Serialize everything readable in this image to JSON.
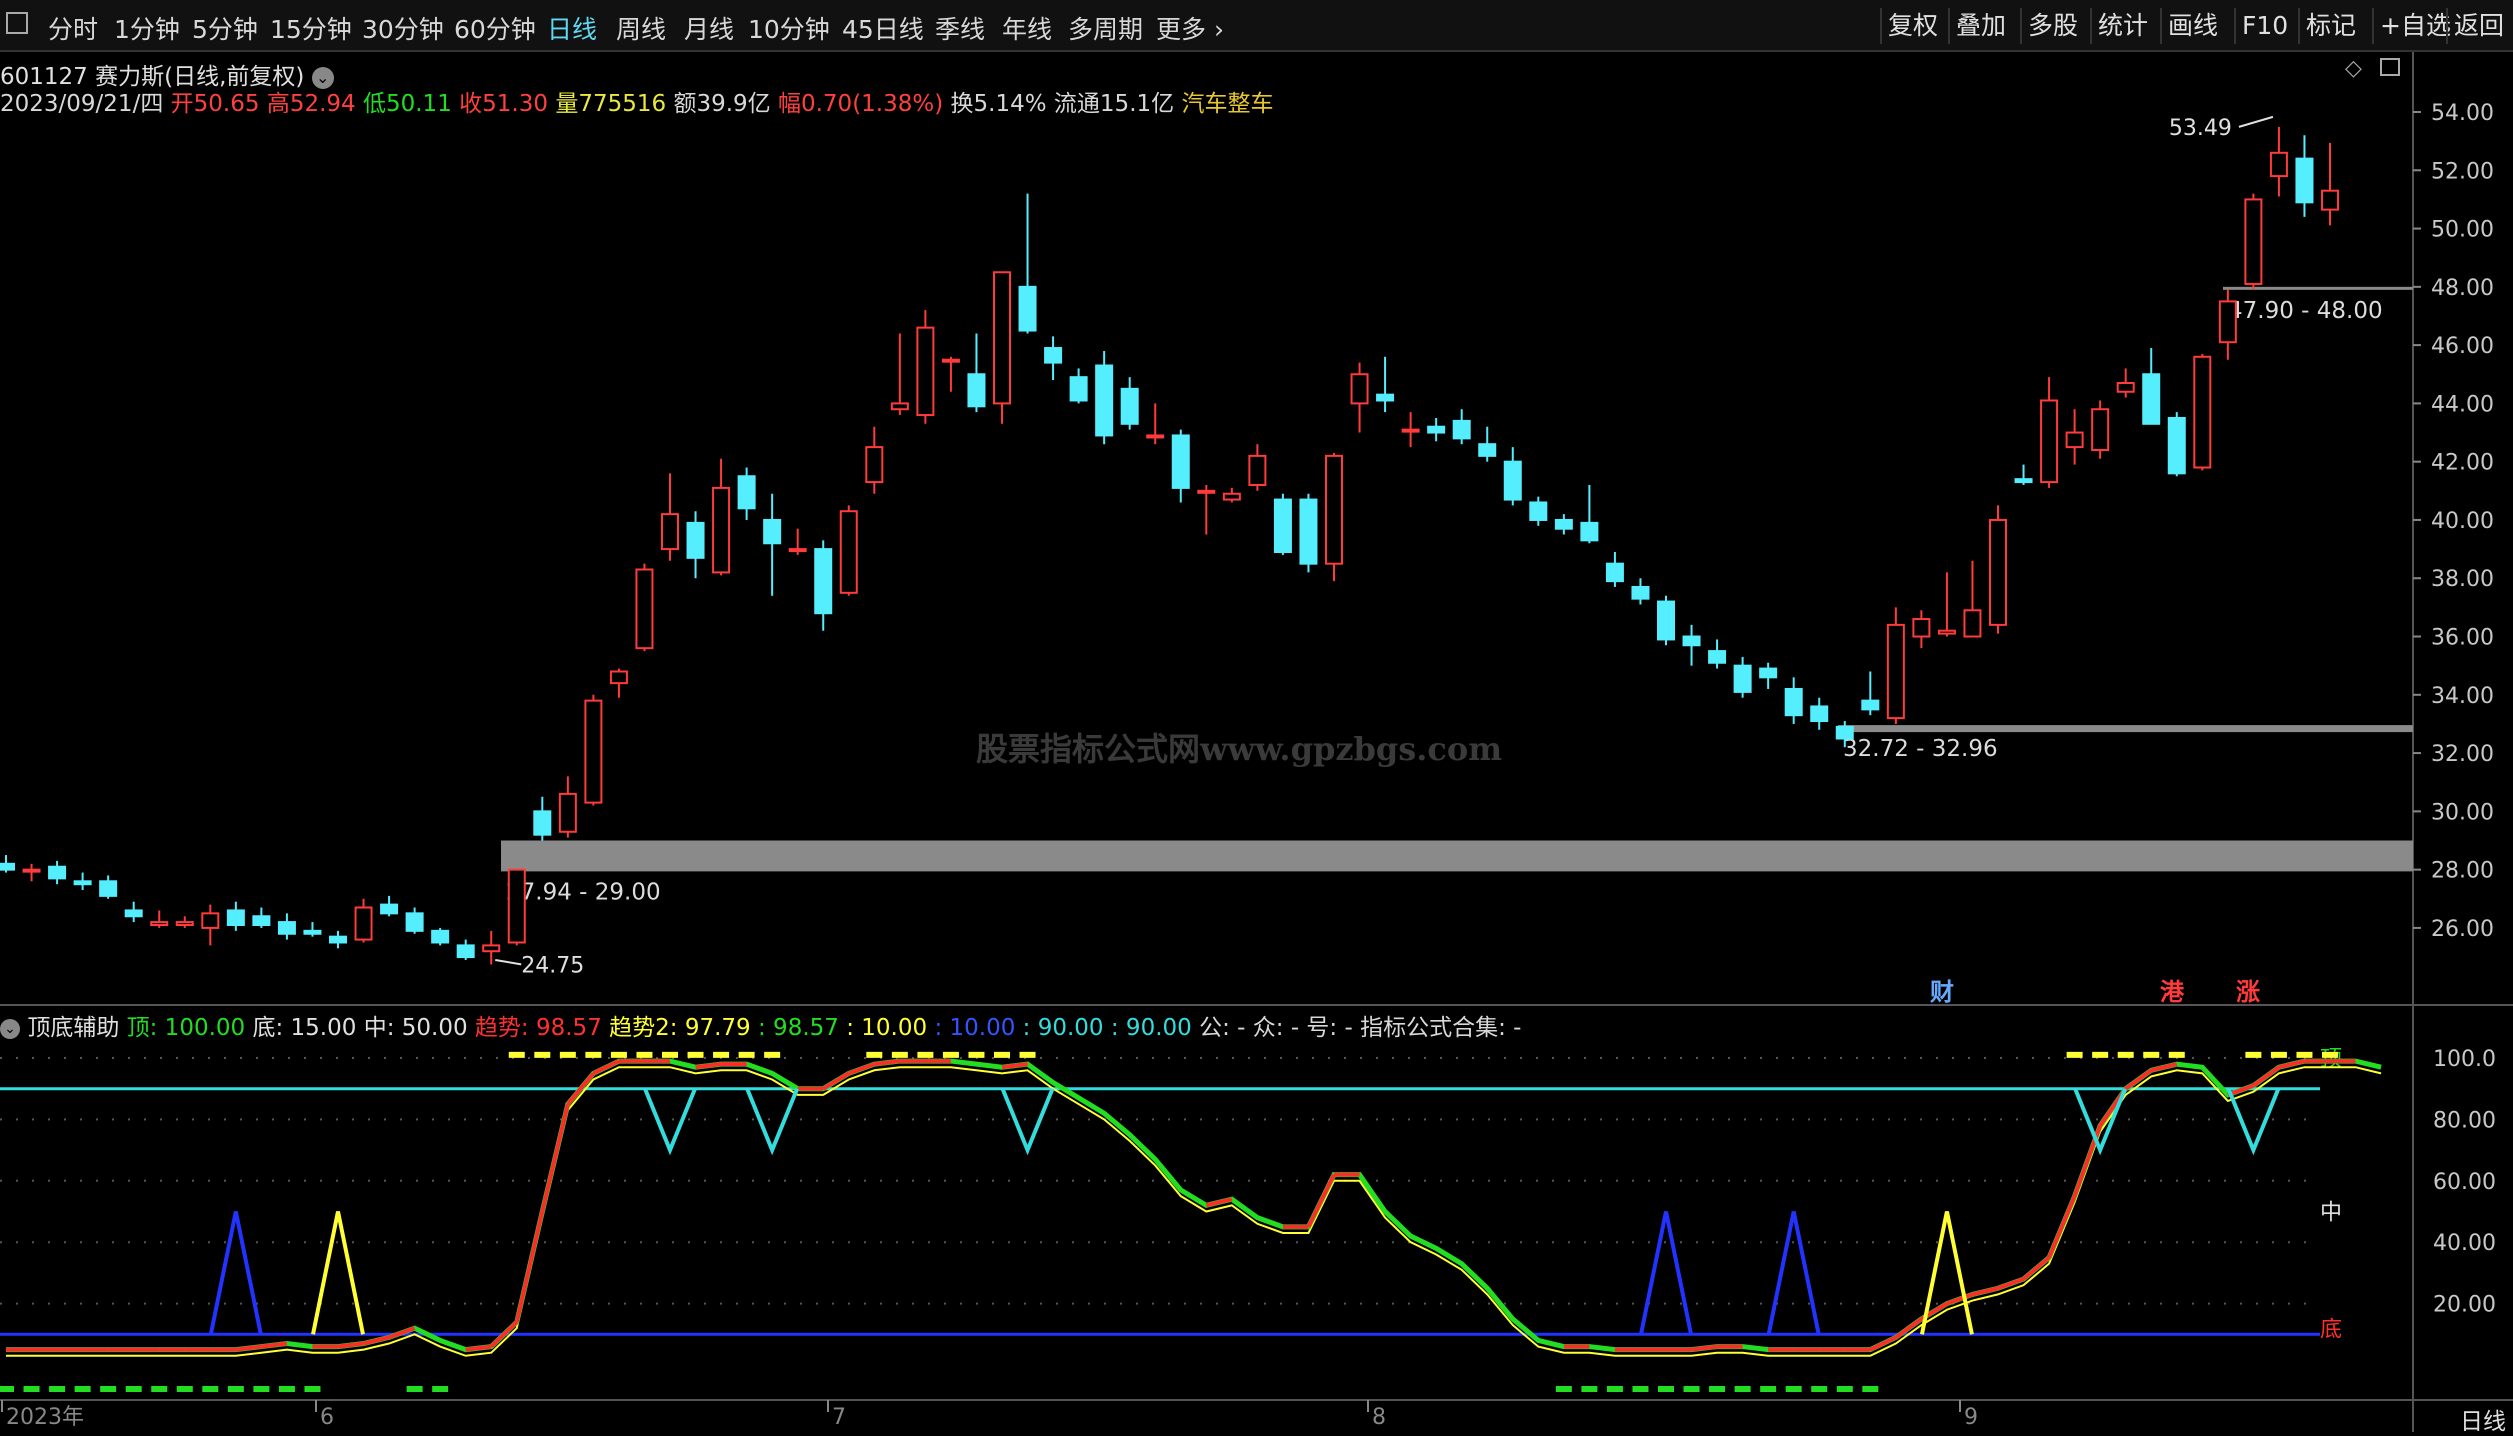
{
  "toolbar": {
    "tabs": [
      "分时",
      "1分钟",
      "5分钟",
      "15分钟",
      "30分钟",
      "60分钟",
      "日线",
      "周线",
      "月线",
      "10分钟",
      "45日线",
      "季线",
      "年线",
      "多周期",
      "更多"
    ],
    "active_tab": "日线",
    "right_buttons": [
      "复权",
      "叠加",
      "多股",
      "统计",
      "画线",
      "F10",
      "标记",
      "+自选",
      "返回"
    ]
  },
  "stock": {
    "code_title": "601127 赛力斯(日线,前复权)",
    "date": "2023/09/21/四",
    "open_label": "开",
    "open": "50.65",
    "high_label": "高",
    "high": "52.94",
    "low_label": "低",
    "low": "50.11",
    "close_label": "收",
    "close": "51.30",
    "volume_label": "量",
    "volume": "775516",
    "amount": "额39.9亿",
    "change_label": "幅",
    "change": "0.70(1.38%)",
    "turnover": "换5.14%",
    "float_cap": "流通15.1亿",
    "sector": "汽车整车"
  },
  "price_axis": [
    "54.00",
    "52.00",
    "50.00",
    "48.00",
    "46.00",
    "44.00",
    "42.00",
    "40.00",
    "38.00",
    "36.00",
    "34.00",
    "32.00",
    "30.00",
    "28.00",
    "26.00"
  ],
  "annotations": {
    "max_label": "53.49",
    "min_label": "24.75",
    "zone_low": "27.94 - 29.00",
    "zone_mid": "32.72 - 32.96",
    "zone_high": "47.90 - 48.00",
    "watermark": "股票指标公式网www.gpzbgs.com"
  },
  "event_tags": [
    "财",
    "港",
    "涨"
  ],
  "indicator": {
    "name": "顶底辅助",
    "items": [
      {
        "label": "顶",
        "value": "100.00",
        "color": "#22dd22"
      },
      {
        "label": "底",
        "value": "15.00",
        "color": "#e0e0e0"
      },
      {
        "label": "中",
        "value": "50.00",
        "color": "#e0e0e0"
      },
      {
        "label": "趋势",
        "value": "98.57",
        "color": "#ff3030"
      },
      {
        "label": "趋势2",
        "value": "97.79",
        "color": "#ffff33"
      },
      {
        "label": "",
        "value": "98.57",
        "color": "#22dd22"
      },
      {
        "label": "",
        "value": "10.00",
        "color": "#ffff33"
      },
      {
        "label": "",
        "value": "10.00",
        "color": "#3355ff"
      },
      {
        "label": "",
        "value": "90.00",
        "color": "#33dddd"
      },
      {
        "label": "",
        "value": "90.00",
        "color": "#33dddd"
      }
    ],
    "extra": "公: - 众: - 号: - 指标公式合集: -",
    "axis": [
      "100.0",
      "80.00",
      "60.00",
      "40.00",
      "20.00"
    ],
    "mark_top": "顶",
    "mark_mid": "中",
    "mark_bottom": "底"
  },
  "date_axis": [
    "2023年",
    "6",
    "7",
    "8",
    "9"
  ],
  "period_label": "日线",
  "chart_data": {
    "type": "candlestick",
    "ylim": [
      24,
      55
    ],
    "candles": [
      {
        "o": 28.2,
        "h": 28.5,
        "l": 27.9,
        "c": 28.0
      },
      {
        "o": 28.0,
        "h": 28.2,
        "l": 27.6,
        "c": 28.0
      },
      {
        "o": 28.1,
        "h": 28.3,
        "l": 27.5,
        "c": 27.7
      },
      {
        "o": 27.6,
        "h": 27.9,
        "l": 27.3,
        "c": 27.5
      },
      {
        "o": 27.6,
        "h": 27.8,
        "l": 27.0,
        "c": 27.1
      },
      {
        "o": 26.6,
        "h": 26.9,
        "l": 26.2,
        "c": 26.4
      },
      {
        "o": 26.1,
        "h": 26.6,
        "l": 26.0,
        "c": 26.2
      },
      {
        "o": 26.1,
        "h": 26.4,
        "l": 26.0,
        "c": 26.2
      },
      {
        "o": 26.0,
        "h": 26.8,
        "l": 25.4,
        "c": 26.5
      },
      {
        "o": 26.6,
        "h": 26.9,
        "l": 25.9,
        "c": 26.1
      },
      {
        "o": 26.4,
        "h": 26.7,
        "l": 26.0,
        "c": 26.1
      },
      {
        "o": 26.2,
        "h": 26.5,
        "l": 25.6,
        "c": 25.8
      },
      {
        "o": 25.9,
        "h": 26.2,
        "l": 25.7,
        "c": 25.8
      },
      {
        "o": 25.7,
        "h": 25.9,
        "l": 25.3,
        "c": 25.5
      },
      {
        "o": 25.6,
        "h": 27.0,
        "l": 25.5,
        "c": 26.7
      },
      {
        "o": 26.8,
        "h": 27.1,
        "l": 26.4,
        "c": 26.5
      },
      {
        "o": 26.5,
        "h": 26.7,
        "l": 25.8,
        "c": 25.9
      },
      {
        "o": 25.9,
        "h": 26.0,
        "l": 25.4,
        "c": 25.5
      },
      {
        "o": 25.4,
        "h": 25.6,
        "l": 24.9,
        "c": 25.0
      },
      {
        "o": 25.2,
        "h": 25.9,
        "l": 24.75,
        "c": 25.4
      },
      {
        "o": 25.5,
        "h": 28.0,
        "l": 25.4,
        "c": 28.0
      },
      {
        "o": 30.0,
        "h": 30.5,
        "l": 29.0,
        "c": 29.2
      },
      {
        "o": 29.3,
        "h": 31.2,
        "l": 29.1,
        "c": 30.6
      },
      {
        "o": 30.3,
        "h": 34.0,
        "l": 30.2,
        "c": 33.8
      },
      {
        "o": 34.4,
        "h": 34.9,
        "l": 33.9,
        "c": 34.8
      },
      {
        "o": 35.6,
        "h": 38.5,
        "l": 35.5,
        "c": 38.3
      },
      {
        "o": 39.0,
        "h": 41.6,
        "l": 38.6,
        "c": 40.2
      },
      {
        "o": 39.9,
        "h": 40.3,
        "l": 38.0,
        "c": 38.7
      },
      {
        "o": 38.2,
        "h": 42.1,
        "l": 38.1,
        "c": 41.1
      },
      {
        "o": 41.5,
        "h": 41.8,
        "l": 40.0,
        "c": 40.4
      },
      {
        "o": 40.0,
        "h": 40.9,
        "l": 37.4,
        "c": 39.2
      },
      {
        "o": 39.0,
        "h": 39.7,
        "l": 38.8,
        "c": 39.0
      },
      {
        "o": 39.0,
        "h": 39.3,
        "l": 36.2,
        "c": 36.8
      },
      {
        "o": 37.5,
        "h": 40.5,
        "l": 37.4,
        "c": 40.3
      },
      {
        "o": 41.3,
        "h": 43.2,
        "l": 40.9,
        "c": 42.5
      },
      {
        "o": 43.8,
        "h": 46.4,
        "l": 43.6,
        "c": 44.0
      },
      {
        "o": 43.6,
        "h": 47.2,
        "l": 43.3,
        "c": 46.6
      },
      {
        "o": 45.5,
        "h": 45.6,
        "l": 44.4,
        "c": 45.5
      },
      {
        "o": 45.0,
        "h": 46.4,
        "l": 43.7,
        "c": 43.9
      },
      {
        "o": 44.0,
        "h": 48.5,
        "l": 43.3,
        "c": 48.5
      },
      {
        "o": 48.0,
        "h": 51.2,
        "l": 46.4,
        "c": 46.5
      },
      {
        "o": 45.9,
        "h": 46.3,
        "l": 44.8,
        "c": 45.4
      },
      {
        "o": 44.9,
        "h": 45.2,
        "l": 44.0,
        "c": 44.1
      },
      {
        "o": 45.3,
        "h": 45.8,
        "l": 42.6,
        "c": 42.9
      },
      {
        "o": 44.5,
        "h": 44.9,
        "l": 43.1,
        "c": 43.3
      },
      {
        "o": 42.9,
        "h": 44.0,
        "l": 42.6,
        "c": 42.9
      },
      {
        "o": 42.9,
        "h": 43.1,
        "l": 40.6,
        "c": 41.1
      },
      {
        "o": 41.0,
        "h": 41.2,
        "l": 39.5,
        "c": 41.0
      },
      {
        "o": 40.7,
        "h": 41.1,
        "l": 40.6,
        "c": 40.9
      },
      {
        "o": 41.2,
        "h": 42.6,
        "l": 41.0,
        "c": 42.2
      },
      {
        "o": 40.7,
        "h": 40.9,
        "l": 38.8,
        "c": 38.9
      },
      {
        "o": 40.7,
        "h": 40.9,
        "l": 38.2,
        "c": 38.5
      },
      {
        "o": 38.5,
        "h": 42.3,
        "l": 37.9,
        "c": 42.2
      },
      {
        "o": 44.0,
        "h": 45.4,
        "l": 43.0,
        "c": 45.0
      },
      {
        "o": 44.3,
        "h": 45.6,
        "l": 43.7,
        "c": 44.1
      },
      {
        "o": 43.1,
        "h": 43.7,
        "l": 42.5,
        "c": 43.1
      },
      {
        "o": 43.2,
        "h": 43.5,
        "l": 42.7,
        "c": 43.0
      },
      {
        "o": 43.4,
        "h": 43.8,
        "l": 42.6,
        "c": 42.8
      },
      {
        "o": 42.6,
        "h": 43.2,
        "l": 42.0,
        "c": 42.2
      },
      {
        "o": 42.0,
        "h": 42.5,
        "l": 40.5,
        "c": 40.7
      },
      {
        "o": 40.6,
        "h": 40.8,
        "l": 39.8,
        "c": 40.0
      },
      {
        "o": 40.0,
        "h": 40.2,
        "l": 39.5,
        "c": 39.7
      },
      {
        "o": 39.9,
        "h": 41.2,
        "l": 39.2,
        "c": 39.3
      },
      {
        "o": 38.5,
        "h": 38.9,
        "l": 37.7,
        "c": 37.9
      },
      {
        "o": 37.7,
        "h": 38.0,
        "l": 37.1,
        "c": 37.3
      },
      {
        "o": 37.2,
        "h": 37.4,
        "l": 35.7,
        "c": 35.9
      },
      {
        "o": 36.0,
        "h": 36.4,
        "l": 35.0,
        "c": 35.7
      },
      {
        "o": 35.5,
        "h": 35.9,
        "l": 34.9,
        "c": 35.1
      },
      {
        "o": 35.0,
        "h": 35.3,
        "l": 33.9,
        "c": 34.1
      },
      {
        "o": 34.9,
        "h": 35.1,
        "l": 34.2,
        "c": 34.6
      },
      {
        "o": 34.2,
        "h": 34.6,
        "l": 33.0,
        "c": 33.3
      },
      {
        "o": 33.6,
        "h": 33.9,
        "l": 32.8,
        "c": 33.1
      },
      {
        "o": 32.9,
        "h": 33.1,
        "l": 32.2,
        "c": 32.5
      },
      {
        "o": 33.8,
        "h": 34.8,
        "l": 33.3,
        "c": 33.5
      },
      {
        "o": 33.2,
        "h": 37.0,
        "l": 33.0,
        "c": 36.4
      },
      {
        "o": 36.0,
        "h": 36.9,
        "l": 35.6,
        "c": 36.6
      },
      {
        "o": 36.1,
        "h": 38.2,
        "l": 36.0,
        "c": 36.2
      },
      {
        "o": 36.0,
        "h": 38.6,
        "l": 36.0,
        "c": 36.9
      },
      {
        "o": 36.4,
        "h": 40.5,
        "l": 36.1,
        "c": 40.0
      },
      {
        "o": 41.4,
        "h": 41.9,
        "l": 41.2,
        "c": 41.3
      },
      {
        "o": 41.3,
        "h": 44.9,
        "l": 41.1,
        "c": 44.1
      },
      {
        "o": 42.5,
        "h": 43.8,
        "l": 41.9,
        "c": 43.0
      },
      {
        "o": 42.4,
        "h": 44.1,
        "l": 42.1,
        "c": 43.8
      },
      {
        "o": 44.4,
        "h": 45.2,
        "l": 44.2,
        "c": 44.7
      },
      {
        "o": 45.0,
        "h": 45.9,
        "l": 43.8,
        "c": 43.3
      },
      {
        "o": 43.5,
        "h": 43.7,
        "l": 41.5,
        "c": 41.6
      },
      {
        "o": 41.8,
        "h": 45.7,
        "l": 41.7,
        "c": 45.6
      },
      {
        "o": 46.1,
        "h": 47.9,
        "l": 45.5,
        "c": 47.5
      },
      {
        "o": 48.1,
        "h": 51.2,
        "l": 47.9,
        "c": 51.0
      },
      {
        "o": 51.8,
        "h": 53.49,
        "l": 51.1,
        "c": 52.6
      },
      {
        "o": 52.4,
        "h": 53.2,
        "l": 50.4,
        "c": 50.9
      },
      {
        "o": 50.65,
        "h": 52.94,
        "l": 50.11,
        "c": 51.3
      }
    ]
  }
}
